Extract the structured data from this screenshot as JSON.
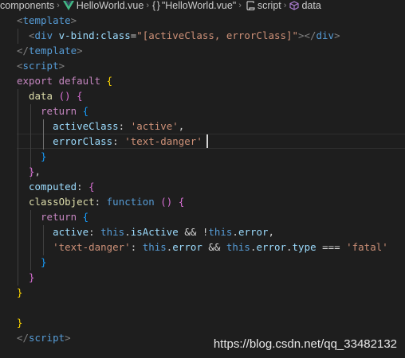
{
  "breadcrumb": {
    "items": [
      {
        "label": "components",
        "icon": "none"
      },
      {
        "label": "HelloWorld.vue",
        "icon": "vue-logo-icon"
      },
      {
        "label": "\"HelloWorld.vue\"",
        "icon": "braces-icon"
      },
      {
        "label": "script",
        "icon": "script-icon"
      },
      {
        "label": "data",
        "icon": "cube-icon"
      }
    ],
    "braces_glyph": "{ }",
    "separator": "›"
  },
  "code": {
    "lines": [
      [
        {
          "t": "<",
          "c": "tk-punc"
        },
        {
          "t": "template",
          "c": "tk-tag"
        },
        {
          "t": ">",
          "c": "tk-punc"
        }
      ],
      [
        {
          "t": "  ",
          "c": "tk-text"
        },
        {
          "t": "<",
          "c": "tk-punc"
        },
        {
          "t": "div",
          "c": "tk-tag"
        },
        {
          "t": " ",
          "c": "tk-text"
        },
        {
          "t": "v-bind:class",
          "c": "tk-attr"
        },
        {
          "t": "=",
          "c": "tk-text"
        },
        {
          "t": "\"[activeClass, errorClass]\"",
          "c": "tk-str"
        },
        {
          "t": "></",
          "c": "tk-punc"
        },
        {
          "t": "div",
          "c": "tk-tag"
        },
        {
          "t": ">",
          "c": "tk-punc"
        }
      ],
      [
        {
          "t": "</",
          "c": "tk-punc"
        },
        {
          "t": "template",
          "c": "tk-tag"
        },
        {
          "t": ">",
          "c": "tk-punc"
        }
      ],
      [
        {
          "t": "<",
          "c": "tk-punc"
        },
        {
          "t": "script",
          "c": "tk-tag"
        },
        {
          "t": ">",
          "c": "tk-punc"
        }
      ],
      [
        {
          "t": "export",
          "c": "tk-kw"
        },
        {
          "t": " ",
          "c": "tk-text"
        },
        {
          "t": "default",
          "c": "tk-kw"
        },
        {
          "t": " ",
          "c": "tk-text"
        },
        {
          "t": "{",
          "c": "tk-b1"
        }
      ],
      [
        {
          "t": "  ",
          "c": "tk-text"
        },
        {
          "t": "data",
          "c": "tk-fn"
        },
        {
          "t": " ",
          "c": "tk-text"
        },
        {
          "t": "()",
          "c": "tk-b2"
        },
        {
          "t": " ",
          "c": "tk-text"
        },
        {
          "t": "{",
          "c": "tk-b2"
        }
      ],
      [
        {
          "t": "    ",
          "c": "tk-text"
        },
        {
          "t": "return",
          "c": "tk-kw"
        },
        {
          "t": " ",
          "c": "tk-text"
        },
        {
          "t": "{",
          "c": "tk-b3"
        }
      ],
      [
        {
          "t": "      ",
          "c": "tk-text"
        },
        {
          "t": "activeClass",
          "c": "tk-prop"
        },
        {
          "t": ": ",
          "c": "tk-text"
        },
        {
          "t": "'active'",
          "c": "tk-str"
        },
        {
          "t": ",",
          "c": "tk-text"
        }
      ],
      [
        {
          "t": "      ",
          "c": "tk-text"
        },
        {
          "t": "errorClass",
          "c": "tk-prop"
        },
        {
          "t": ": ",
          "c": "tk-text"
        },
        {
          "t": "'text-danger'",
          "c": "tk-str"
        }
      ],
      [
        {
          "t": "    ",
          "c": "tk-text"
        },
        {
          "t": "}",
          "c": "tk-b3"
        }
      ],
      [
        {
          "t": "  ",
          "c": "tk-text"
        },
        {
          "t": "}",
          "c": "tk-b2"
        },
        {
          "t": ",",
          "c": "tk-text"
        }
      ],
      [
        {
          "t": "  ",
          "c": "tk-text"
        },
        {
          "t": "computed",
          "c": "tk-prop"
        },
        {
          "t": ": ",
          "c": "tk-text"
        },
        {
          "t": "{",
          "c": "tk-b2"
        }
      ],
      [
        {
          "t": "  ",
          "c": "tk-text"
        },
        {
          "t": "classObject",
          "c": "tk-fn"
        },
        {
          "t": ": ",
          "c": "tk-text"
        },
        {
          "t": "function",
          "c": "tk-decl"
        },
        {
          "t": " ",
          "c": "tk-text"
        },
        {
          "t": "()",
          "c": "tk-b2"
        },
        {
          "t": " ",
          "c": "tk-text"
        },
        {
          "t": "{",
          "c": "tk-b2"
        }
      ],
      [
        {
          "t": "    ",
          "c": "tk-text"
        },
        {
          "t": "return",
          "c": "tk-kw"
        },
        {
          "t": " ",
          "c": "tk-text"
        },
        {
          "t": "{",
          "c": "tk-b3"
        }
      ],
      [
        {
          "t": "      ",
          "c": "tk-text"
        },
        {
          "t": "active",
          "c": "tk-prop"
        },
        {
          "t": ": ",
          "c": "tk-text"
        },
        {
          "t": "this",
          "c": "tk-decl"
        },
        {
          "t": ".",
          "c": "tk-text"
        },
        {
          "t": "isActive",
          "c": "tk-prop"
        },
        {
          "t": " && !",
          "c": "tk-text"
        },
        {
          "t": "this",
          "c": "tk-decl"
        },
        {
          "t": ".",
          "c": "tk-text"
        },
        {
          "t": "error",
          "c": "tk-prop"
        },
        {
          "t": ",",
          "c": "tk-text"
        }
      ],
      [
        {
          "t": "      ",
          "c": "tk-text"
        },
        {
          "t": "'text-danger'",
          "c": "tk-str"
        },
        {
          "t": ": ",
          "c": "tk-text"
        },
        {
          "t": "this",
          "c": "tk-decl"
        },
        {
          "t": ".",
          "c": "tk-text"
        },
        {
          "t": "error",
          "c": "tk-prop"
        },
        {
          "t": " && ",
          "c": "tk-text"
        },
        {
          "t": "this",
          "c": "tk-decl"
        },
        {
          "t": ".",
          "c": "tk-text"
        },
        {
          "t": "error",
          "c": "tk-prop"
        },
        {
          "t": ".",
          "c": "tk-text"
        },
        {
          "t": "type",
          "c": "tk-prop"
        },
        {
          "t": " === ",
          "c": "tk-text"
        },
        {
          "t": "'fatal'",
          "c": "tk-str"
        }
      ],
      [
        {
          "t": "    ",
          "c": "tk-text"
        },
        {
          "t": "}",
          "c": "tk-b3"
        }
      ],
      [
        {
          "t": "  ",
          "c": "tk-text"
        },
        {
          "t": "}",
          "c": "tk-b2"
        }
      ],
      [
        {
          "t": "}",
          "c": "tk-b1"
        }
      ],
      [],
      [
        {
          "t": "}",
          "c": "tk-b1"
        }
      ],
      [
        {
          "t": "</",
          "c": "tk-punc"
        },
        {
          "t": "script",
          "c": "tk-tag"
        },
        {
          "t": ">",
          "c": "tk-punc"
        }
      ]
    ]
  },
  "watermark": "https://blog.csdn.net/qq_33482132",
  "colors": {
    "background": "#1e1e1e",
    "tag": "#569cd6",
    "string": "#ce9178",
    "keyword": "#c586c0",
    "property": "#9cdcfe",
    "function": "#dcdcaa",
    "bracket_level1": "#ffd700",
    "bracket_level2": "#da70d6",
    "bracket_level3": "#179fff"
  }
}
